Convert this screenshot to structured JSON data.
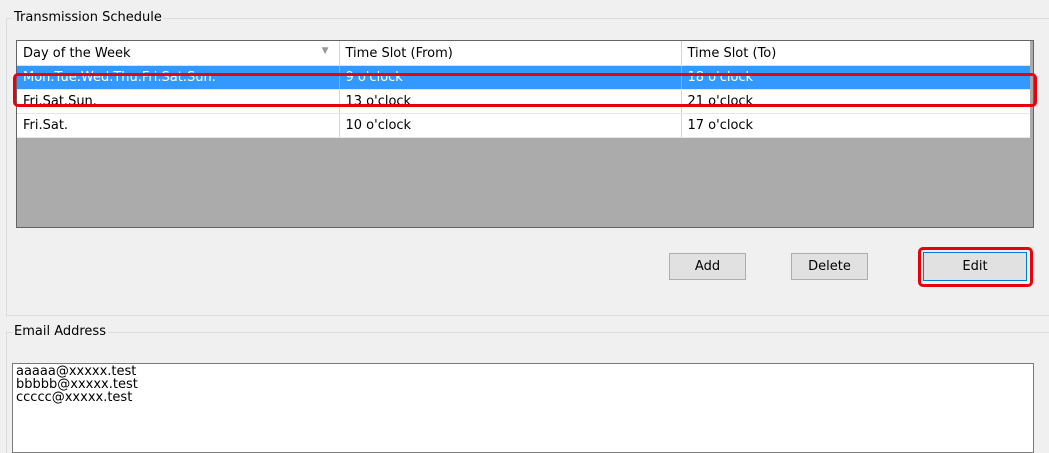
{
  "schedule": {
    "title": "Transmission Schedule",
    "columns": [
      "Day of the Week",
      "Time Slot (From)",
      "Time Slot (To)"
    ],
    "rows": [
      {
        "day": "Mon.Tue.Wed.Thu.Fri.Sat.Sun.",
        "from": "9 o'clock",
        "to": "18 o'clock",
        "selected": true
      },
      {
        "day": "Fri.Sat.Sun.",
        "from": "13 o'clock",
        "to": "21 o'clock",
        "selected": false
      },
      {
        "day": "Fri.Sat.",
        "from": "10 o'clock",
        "to": "17 o'clock",
        "selected": false
      }
    ]
  },
  "buttons": {
    "add": "Add",
    "delete": "Delete",
    "edit": "Edit"
  },
  "email": {
    "title": "Email Address",
    "addresses": [
      "aaaaa@xxxxx.test",
      "bbbbb@xxxxx.test",
      "ccccc@xxxxx.test"
    ]
  },
  "colors": {
    "selection": "#3399ff",
    "highlight": "#e8000b"
  }
}
